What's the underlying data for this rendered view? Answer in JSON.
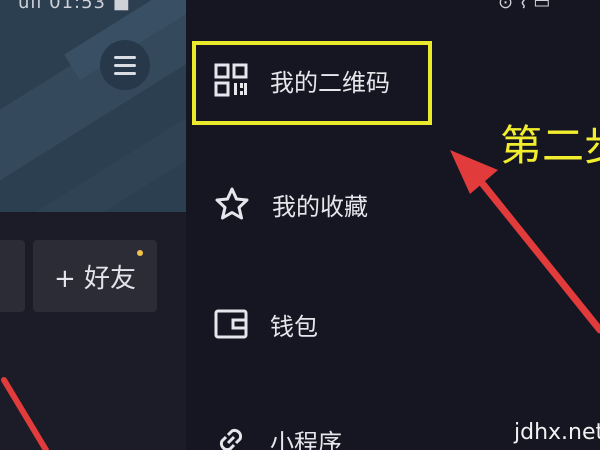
{
  "status_bar": {
    "left_text": "ull 01:53 ■",
    "right_text": "⊙ ⌇ ▭"
  },
  "profile": {
    "add_friend_label": "+ 好友"
  },
  "drawer": {
    "items": [
      {
        "label": "我的二维码",
        "icon": "qr-code-icon"
      },
      {
        "label": "我的收藏",
        "icon": "star-icon"
      },
      {
        "label": "钱包",
        "icon": "wallet-icon"
      },
      {
        "label": "小程序",
        "icon": "link-icon"
      }
    ]
  },
  "annotation": {
    "step_text": "第二步",
    "highlight_color": "#eaea2a",
    "arrow_color": "#e23b3b"
  },
  "watermark": "jdhx.net"
}
